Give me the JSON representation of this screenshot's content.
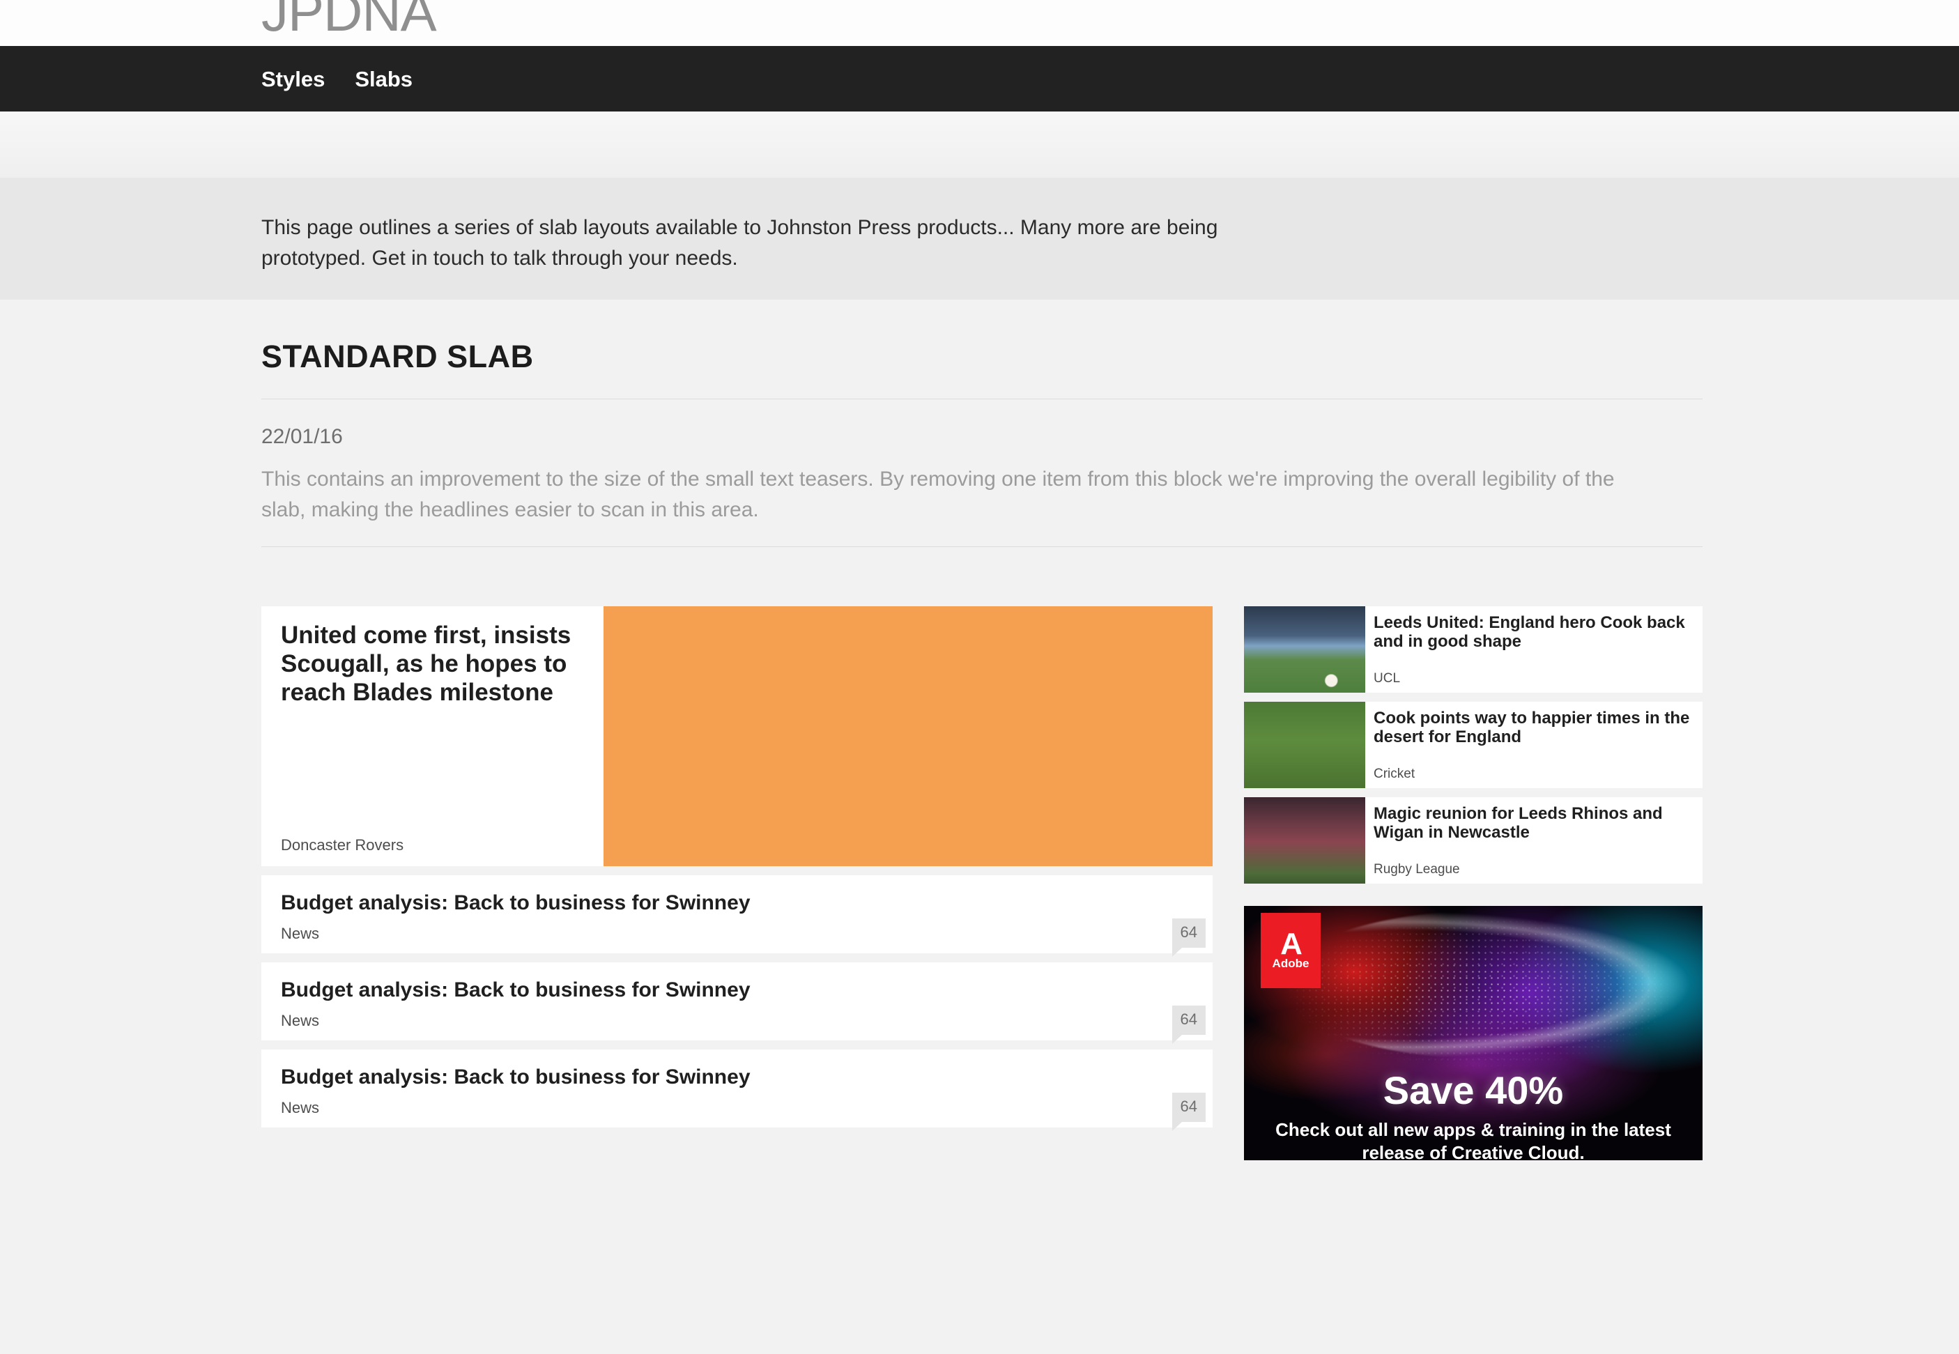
{
  "header": {
    "logo": "JPDNA",
    "nav": [
      {
        "label": "Styles"
      },
      {
        "label": "Slabs"
      }
    ]
  },
  "intro": {
    "text": "This page outlines a series of slab layouts available to Johnston Press products... Many more are being prototyped. Get in touch to talk through your needs."
  },
  "section": {
    "title": "STANDARD SLAB",
    "date": "22/01/16",
    "description": "This contains an improvement to the size of the small text teasers. By removing one item from this block we're improving the overall legibility of the slab, making the headlines easier to scan in this area."
  },
  "slab": {
    "lead": {
      "headline": "United come first, insists Scougall, as he hopes to reach Blades milestone",
      "section": "Doncaster Rovers",
      "image_color": "#f5a051"
    },
    "list_rows": [
      {
        "headline": "Budget analysis: Back to business for Swinney",
        "section": "News",
        "comments": "64"
      },
      {
        "headline": "Budget analysis: Back to business for Swinney",
        "section": "News",
        "comments": "64"
      },
      {
        "headline": "Budget analysis: Back to business for Swinney",
        "section": "News",
        "comments": "64"
      }
    ],
    "side_cards": [
      {
        "headline": "Leeds United: England hero Cook back and in good shape",
        "section": "UCL",
        "thumb": "football-photo"
      },
      {
        "headline": "Cook points way to happier times in the desert for England",
        "section": "Cricket",
        "thumb": "cricket-photo"
      },
      {
        "headline": "Magic reunion for Leeds Rhinos and Wigan in Newcastle",
        "section": "Rugby League",
        "thumb": "rugby-photo"
      }
    ],
    "advert": {
      "brand_mark": "A",
      "brand_name": "Adobe",
      "headline": "Save 40%",
      "subtext": "Check out all new apps & training in the latest release of Creative Cloud."
    }
  },
  "colors": {
    "nav_background": "#222222",
    "page_background": "#f2f2f2",
    "intro_background": "#e7e7e7",
    "accent_orange": "#f5a051",
    "adobe_red": "#ec1c24"
  }
}
